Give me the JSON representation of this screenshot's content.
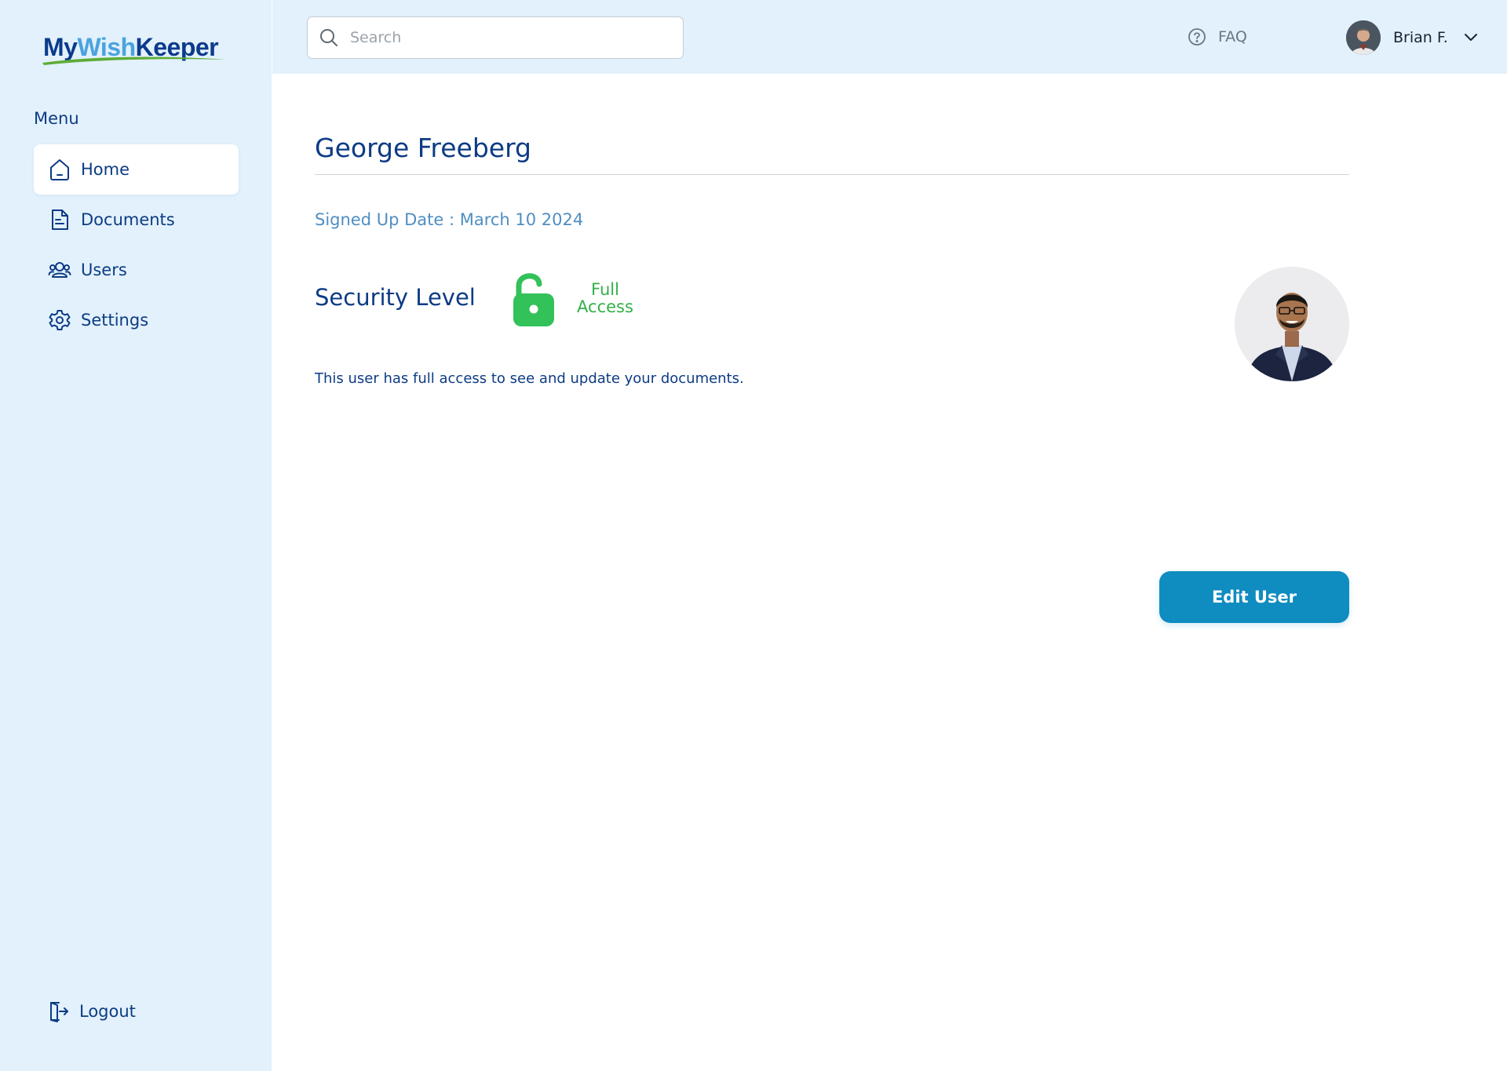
{
  "brand": {
    "part1": "My",
    "part2": "Wish",
    "part3": "Keeper"
  },
  "sidebar": {
    "menu_label": "Menu",
    "items": [
      {
        "label": "Home",
        "icon": "home-icon",
        "active": true
      },
      {
        "label": "Documents",
        "icon": "document-icon",
        "active": false
      },
      {
        "label": "Users",
        "icon": "users-icon",
        "active": false
      },
      {
        "label": "Settings",
        "icon": "gear-icon",
        "active": false
      }
    ],
    "logout_label": "Logout"
  },
  "header": {
    "search_placeholder": "Search",
    "faq_label": "FAQ",
    "user_name": "Brian F."
  },
  "profile": {
    "name": "George Freeberg",
    "signup_text": "Signed Up Date : March 10 2024",
    "security_label": "Security Level",
    "access_line1": "Full",
    "access_line2": "Access",
    "description": "This user has full access to see and update your documents.",
    "edit_button": "Edit User"
  },
  "colors": {
    "primary_navy": "#0d3b84",
    "sidebar_bg": "#e2f1fc",
    "access_green": "#33b04a",
    "button_blue": "#0f8cc0",
    "link_blue": "#4f8ec2"
  }
}
